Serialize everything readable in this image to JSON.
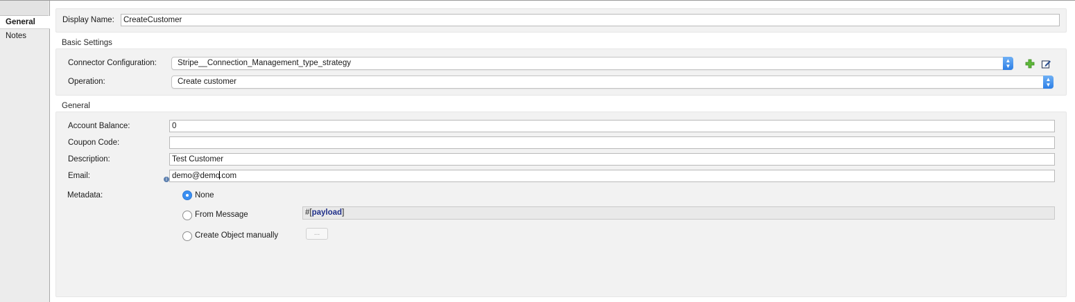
{
  "tabs": [
    {
      "label": "General",
      "active": true
    },
    {
      "label": "Notes",
      "active": false
    }
  ],
  "display_name": {
    "label": "Display Name:",
    "value": "CreateCustomer"
  },
  "basic_settings": {
    "title": "Basic Settings",
    "connector_configuration": {
      "label": "Connector Configuration:",
      "value": "Stripe__Connection_Management_type_strategy"
    },
    "operation": {
      "label": "Operation:",
      "value": "Create customer"
    }
  },
  "general": {
    "title": "General",
    "fields": [
      {
        "label": "Account Balance:",
        "value": "0"
      },
      {
        "label": "Coupon Code:",
        "value": ""
      },
      {
        "label": "Description:",
        "value": "Test Customer"
      },
      {
        "label": "Email:",
        "value_before_caret": "demo@demo",
        "value_after_caret": ".com"
      }
    ],
    "metadata": {
      "label": "Metadata:",
      "options": [
        {
          "label": "None",
          "selected": true
        },
        {
          "label": "From Message",
          "selected": false
        },
        {
          "label": "Create Object manually",
          "selected": false
        }
      ],
      "payload_prefix": "#[",
      "payload_expression": "payload",
      "payload_suffix": "]",
      "ellipsis_label": "..."
    }
  },
  "icons": [
    "add-icon",
    "edit-icon",
    "info-icon",
    "chevron-updown-icon"
  ],
  "colors": {
    "accent": "#3a8ff2",
    "panel": "#f2f2f2",
    "expression": "#1f2f8a"
  }
}
